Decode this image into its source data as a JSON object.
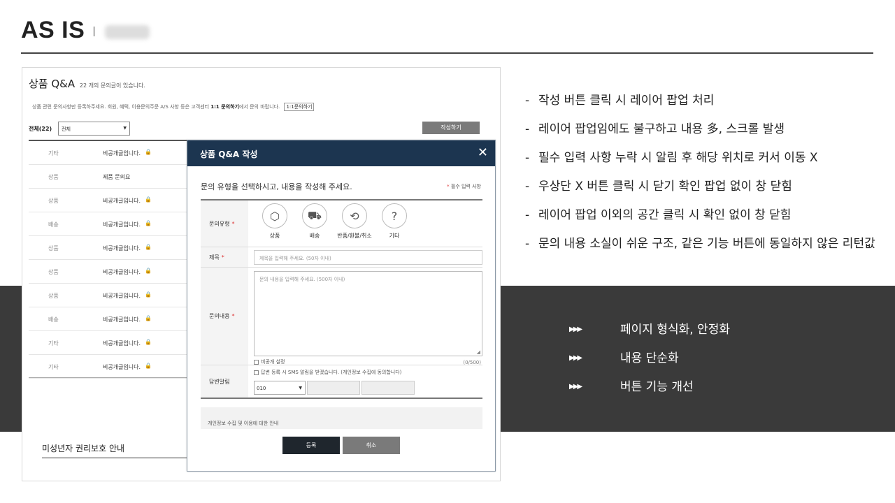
{
  "slide": {
    "title": "AS IS"
  },
  "screenshot": {
    "title": "상품 Q&A",
    "count_text": "22 개의 문의글이 있습니다.",
    "notice_text": "상품 관련 문의사항만 등록하주세요. 회원, 혜택, 이용문의주문 A/S 사항 등은 고객센터 ",
    "notice_bold": "1:1 문의하기",
    "notice_tail": "에서 문의 바랍니다.",
    "notice_button": "1:1문의하기",
    "filter_label": "전체(22)",
    "filter_value": "전체",
    "write_button": "작성하기",
    "rows": [
      {
        "category": "기타",
        "subject": "비공개글입니다.",
        "locked": "🔒"
      },
      {
        "category": "상품",
        "subject": "제품 문의요",
        "locked": ""
      },
      {
        "category": "상품",
        "subject": "비공개글입니다.",
        "locked": "🔒"
      },
      {
        "category": "배송",
        "subject": "비공개글입니다.",
        "locked": "🔒"
      },
      {
        "category": "상품",
        "subject": "비공개글입니다.",
        "locked": "🔒"
      },
      {
        "category": "상품",
        "subject": "비공개글입니다.",
        "locked": "🔒"
      },
      {
        "category": "상품",
        "subject": "비공개글입니다.",
        "locked": "🔒"
      },
      {
        "category": "배송",
        "subject": "비공개글입니다.",
        "locked": "🔒"
      },
      {
        "category": "기타",
        "subject": "비공개글입니다.",
        "locked": "🔒"
      },
      {
        "category": "기타",
        "subject": "비공개글입니다.",
        "locked": "🔒"
      }
    ],
    "minor_link": "미성년자 권리보호 안내"
  },
  "modal": {
    "title": "상품 Q&A 작성",
    "close": "✕",
    "intro": "문의 유형을 선택하시고, 내용을 작성해 주세요.",
    "required_note": "필수 입력 사항",
    "type_label": "문의유형",
    "types": [
      {
        "label": "상품",
        "icon": "box-icon",
        "glyph": "⬡"
      },
      {
        "label": "배송",
        "icon": "truck-icon",
        "glyph": "⛟"
      },
      {
        "label": "반품/환불/취소",
        "icon": "refund-icon",
        "glyph": "⟲"
      },
      {
        "label": "기타",
        "icon": "question-icon",
        "glyph": "?"
      }
    ],
    "subject_label": "제목",
    "subject_placeholder": "제목을 입력해 주세요. (50자 이내)",
    "content_label": "문의내용",
    "content_placeholder": "문의 내용을 입력해 주세요. (500자 이내)",
    "private_label": "비공개 설정",
    "char_counter": "(0/500)",
    "notify_label": "답변알림",
    "sms_text": "답변 등록 시 SMS 알림을 받겠습니다. (개인정보 수집에 동의합니다)",
    "phone_prefix": "010",
    "privacy_title": "개인정보 수집 및 이용에 대한 안내",
    "submit": "등록",
    "cancel": "취소"
  },
  "issues": [
    "작성 버튼 클릭 시 레이어 팝업 처리",
    "레이어 팝업임에도 불구하고 내용 多, 스크롤 발생",
    "필수 입력 사항 누락 시 알림 후 해당 위치로 커서 이동 X",
    "우상단 X 버튼 클릭 시 닫기 확인 팝업 없이 창 닫힘",
    "레이어 팝업 이외의 공간 클릭 시 확인 없이 창 닫힘",
    "문의 내용 소실이 쉬운 구조, 같은 기능 버튼에 동일하지 않은 리턴값"
  ],
  "issue_marker": "-",
  "improvements": [
    "페이지 형식화, 안정화",
    "내용 단순화",
    "버튼 기능 개선"
  ],
  "improvement_marker": "▶▶▶"
}
